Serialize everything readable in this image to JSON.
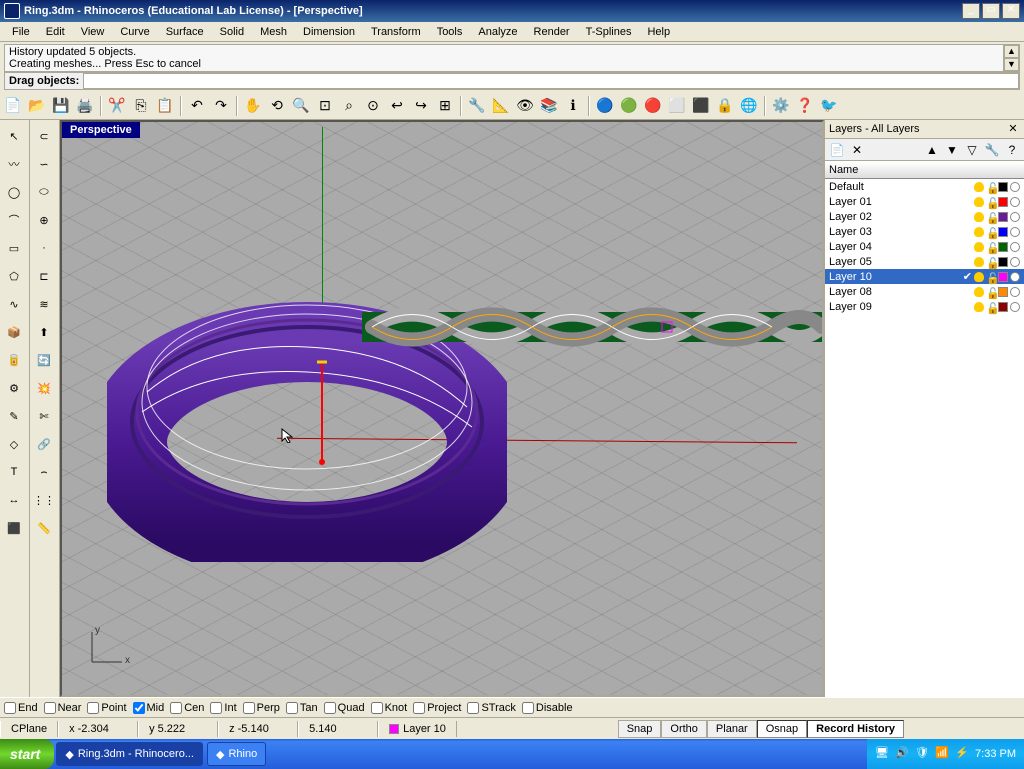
{
  "window": {
    "title": "Ring.3dm - Rhinoceros (Educational Lab License) - [Perspective]"
  },
  "menu": [
    "File",
    "Edit",
    "View",
    "Curve",
    "Surface",
    "Solid",
    "Mesh",
    "Dimension",
    "Transform",
    "Tools",
    "Analyze",
    "Render",
    "T-Splines",
    "Help"
  ],
  "commandlog": {
    "line1": "History updated 5 objects.",
    "line2": "Creating meshes... Press Esc to cancel"
  },
  "commandprompt": {
    "label": "Drag objects:"
  },
  "viewport": {
    "name": "Perspective",
    "axis_x": "x",
    "axis_y": "y"
  },
  "layers_panel": {
    "title": "Layers - All Layers",
    "header_name": "Name",
    "items": [
      {
        "name": "Default",
        "color": "#000000",
        "on": true,
        "sel": false
      },
      {
        "name": "Layer 01",
        "color": "#ff0000",
        "on": true,
        "sel": false
      },
      {
        "name": "Layer 02",
        "color": "#6a1b9a",
        "on": true,
        "sel": false
      },
      {
        "name": "Layer 03",
        "color": "#0000ff",
        "on": true,
        "sel": false
      },
      {
        "name": "Layer 04",
        "color": "#006400",
        "on": true,
        "sel": false
      },
      {
        "name": "Layer 05",
        "color": "#000000",
        "on": true,
        "sel": false
      },
      {
        "name": "Layer 10",
        "color": "#ff00ff",
        "on": true,
        "sel": true,
        "check": true
      },
      {
        "name": "Layer 08",
        "color": "#ff8c00",
        "on": true,
        "sel": false
      },
      {
        "name": "Layer 09",
        "color": "#8b0000",
        "on": true,
        "sel": false
      }
    ]
  },
  "osnap": {
    "items": [
      {
        "label": "End",
        "checked": false
      },
      {
        "label": "Near",
        "checked": false
      },
      {
        "label": "Point",
        "checked": false
      },
      {
        "label": "Mid",
        "checked": true
      },
      {
        "label": "Cen",
        "checked": false
      },
      {
        "label": "Int",
        "checked": false
      },
      {
        "label": "Perp",
        "checked": false
      },
      {
        "label": "Tan",
        "checked": false
      },
      {
        "label": "Quad",
        "checked": false
      },
      {
        "label": "Knot",
        "checked": false
      },
      {
        "label": "Project",
        "checked": false
      },
      {
        "label": "STrack",
        "checked": false
      },
      {
        "label": "Disable",
        "checked": false
      }
    ]
  },
  "status": {
    "cplane": "CPlane",
    "x": "x -2.304",
    "y": "y 5.222",
    "z": "z -5.140",
    "dist": "5.140",
    "layer": "Layer 10",
    "snap": "Snap",
    "ortho": "Ortho",
    "planar": "Planar",
    "osnap": "Osnap",
    "record": "Record History"
  },
  "taskbar": {
    "start": "start",
    "items": [
      {
        "label": "Ring.3dm - Rhinocero...",
        "active": true
      },
      {
        "label": "Rhino",
        "active": false
      }
    ],
    "clock": "7:33 PM"
  }
}
